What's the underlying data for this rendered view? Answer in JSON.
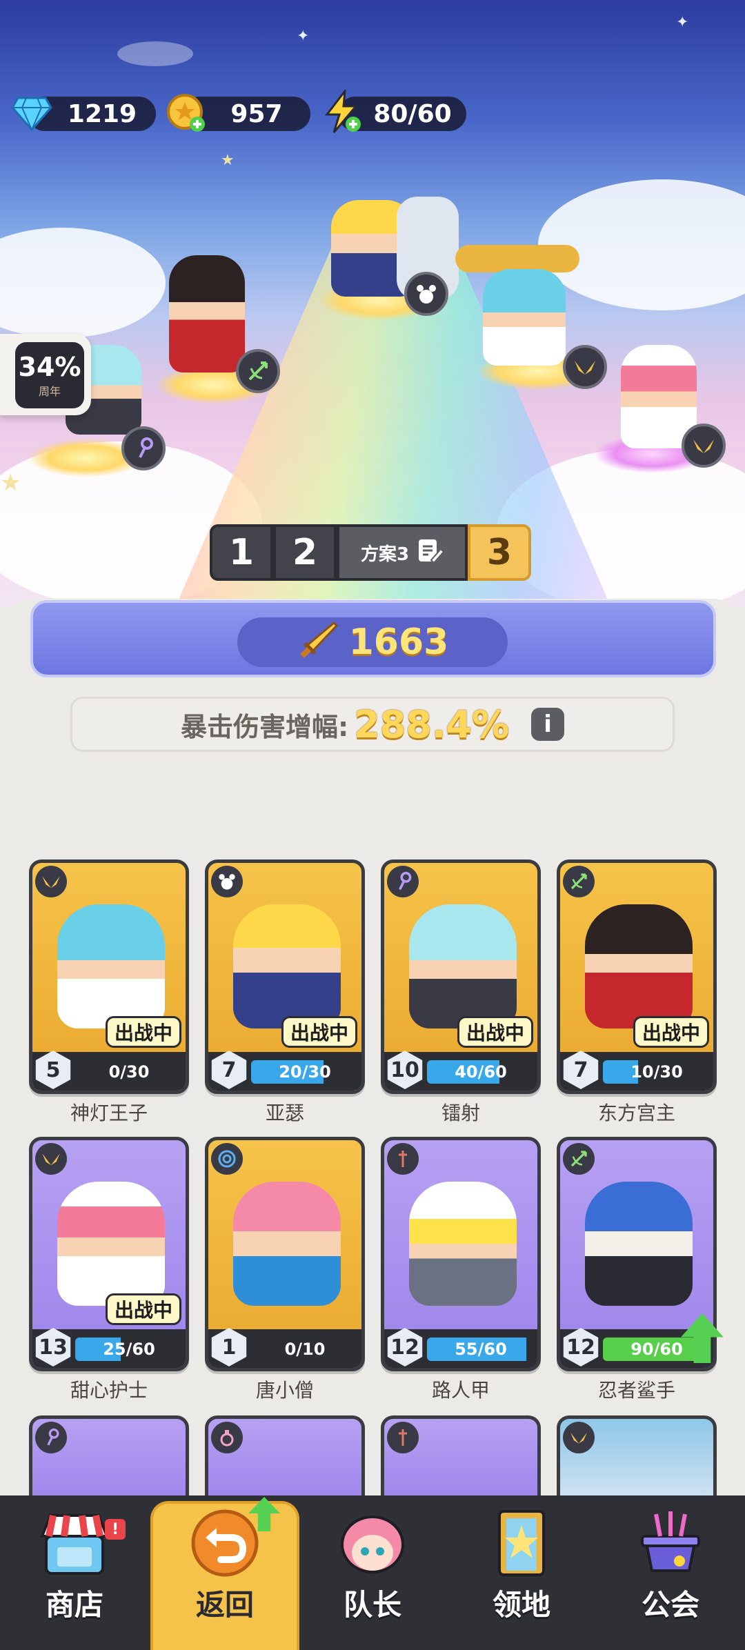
{
  "resources": {
    "gems": "1219",
    "gold": "957",
    "energy": "80/60"
  },
  "side_widget": {
    "percent": "34%",
    "sub": "周年"
  },
  "presets": {
    "slot1": "1",
    "slot2": "2",
    "name": "方案3",
    "slot3": "3"
  },
  "power": "1663",
  "stat": {
    "label": "暴击伤害增幅:",
    "value": "288.4%"
  },
  "deploy_label": "出战中",
  "heroes": [
    {
      "name": "神灯王子",
      "level": "5",
      "progress": "0/30",
      "progress_fraction": 0.0,
      "role_icon": "wings-icon",
      "deployed": true,
      "theme": "gold"
    },
    {
      "name": "亚瑟",
      "level": "7",
      "progress": "20/30",
      "progress_fraction": 0.67,
      "role_icon": "paw-icon",
      "deployed": true,
      "theme": "gold"
    },
    {
      "name": "镭射",
      "level": "10",
      "progress": "40/60",
      "progress_fraction": 0.67,
      "role_icon": "staff-icon",
      "deployed": true,
      "theme": "gold"
    },
    {
      "name": "东方宫主",
      "level": "7",
      "progress": "10/30",
      "progress_fraction": 0.33,
      "role_icon": "bow-icon",
      "deployed": true,
      "theme": "gold"
    },
    {
      "name": "甜心护士",
      "level": "13",
      "progress": "25/60",
      "progress_fraction": 0.42,
      "role_icon": "wings-icon",
      "deployed": true,
      "theme": "purple"
    },
    {
      "name": "唐小僧",
      "level": "1",
      "progress": "0/10",
      "progress_fraction": 0.0,
      "role_icon": "spiral-icon",
      "deployed": false,
      "theme": "gold"
    },
    {
      "name": "路人甲",
      "level": "12",
      "progress": "55/60",
      "progress_fraction": 0.92,
      "role_icon": "sword-icon",
      "deployed": false,
      "theme": "purple"
    },
    {
      "name": "忍者鲨手",
      "level": "12",
      "progress": "90/60",
      "progress_fraction": 1.0,
      "role_icon": "bow-icon",
      "deployed": false,
      "theme": "purple",
      "upgrade": true
    }
  ],
  "nav": [
    {
      "label": "商店",
      "icon": "shop-icon"
    },
    {
      "label": "返回",
      "icon": "return-icon"
    },
    {
      "label": "队长",
      "icon": "captain-icon"
    },
    {
      "label": "领地",
      "icon": "territory-icon"
    },
    {
      "label": "公会",
      "icon": "guild-icon"
    }
  ],
  "colors": {
    "gold_card": "#f6c34a",
    "purple_card": "#b7a1f3",
    "progress_blue": "#39a8ea",
    "progress_green": "#58cf4a",
    "power_text": "#ffe47a"
  }
}
